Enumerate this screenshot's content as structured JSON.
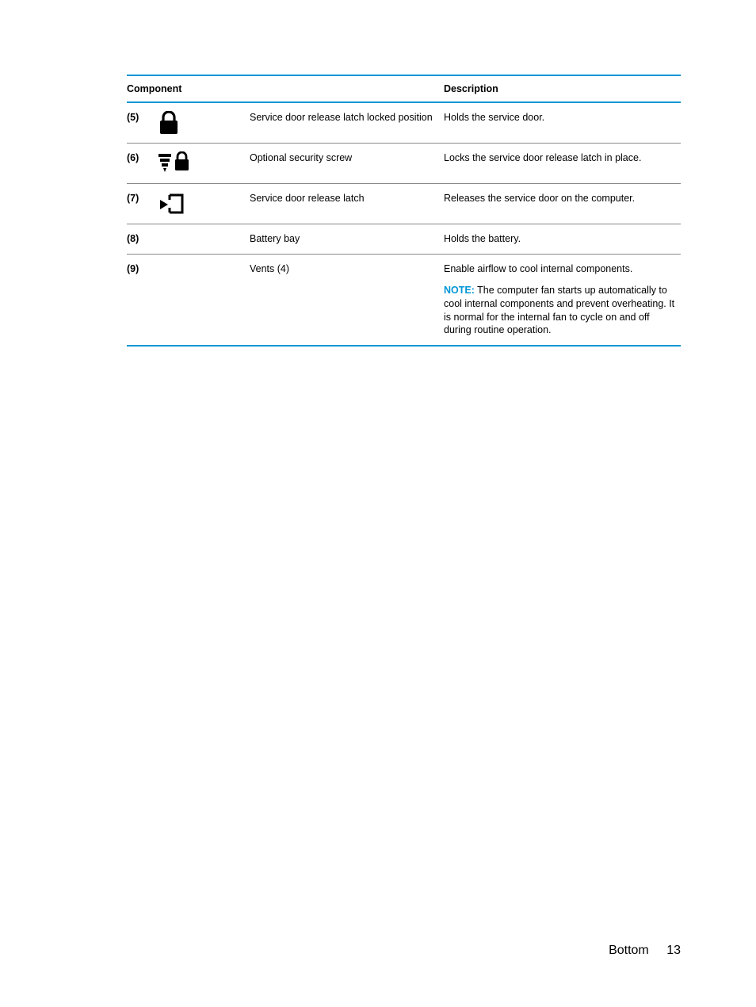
{
  "table": {
    "headers": {
      "component": "Component",
      "description": "Description"
    },
    "rows": [
      {
        "num": "(5)",
        "icon": "lock-icon",
        "component": "Service door release latch locked position",
        "description": "Holds the service door.",
        "note": null
      },
      {
        "num": "(6)",
        "icon": "screw-lock-icon",
        "component": "Optional security screw",
        "description": "Locks the service door release latch in place.",
        "note": null
      },
      {
        "num": "(7)",
        "icon": "release-latch-icon",
        "component": "Service door release latch",
        "description": "Releases the service door on the computer.",
        "note": null
      },
      {
        "num": "(8)",
        "icon": null,
        "component": "Battery bay",
        "description": "Holds the battery.",
        "note": null
      },
      {
        "num": "(9)",
        "icon": null,
        "component": "Vents (4)",
        "description": "Enable airflow to cool internal components.",
        "note": {
          "label": "NOTE:",
          "text": "The computer fan starts up automatically to cool internal components and prevent overheating. It is normal for the internal fan to cycle on and off during routine operation."
        }
      }
    ]
  },
  "footer": {
    "section": "Bottom",
    "page": "13"
  }
}
